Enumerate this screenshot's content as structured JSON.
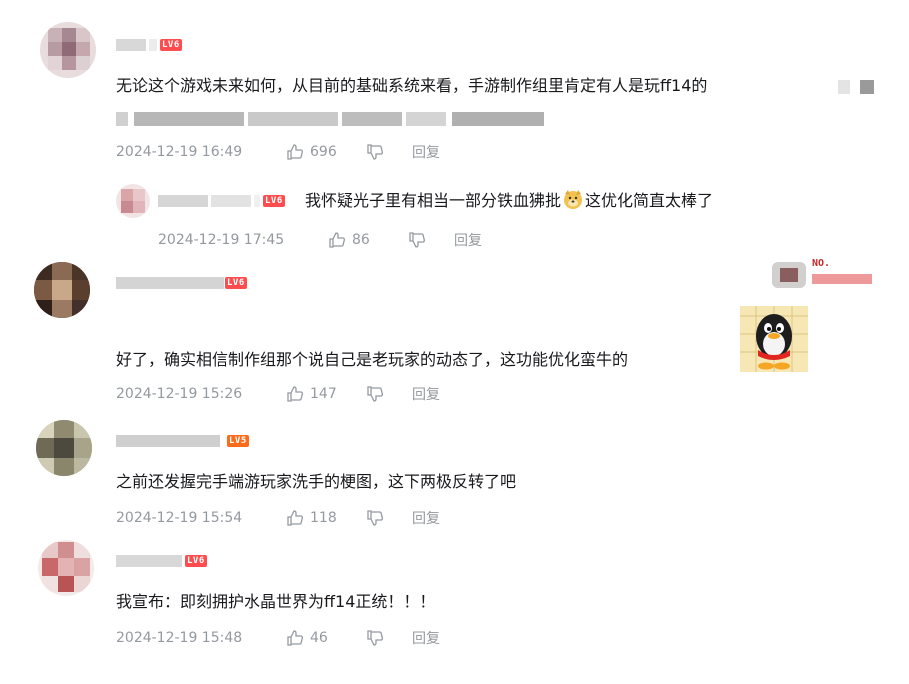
{
  "comments": [
    {
      "level": "LV6",
      "text": "无论这个游戏未来如何，从目前的基础系统来看，手游制作组里肯定有人是玩ff14的",
      "time": "2024-12-19 16:49",
      "likes": "696",
      "reply_label": "回复",
      "replies": [
        {
          "level": "LV6",
          "text": "我怀疑光子里有相当一部分铁血狒批",
          "text_after_emoji": "这优化简直太棒了",
          "time": "2024-12-19 17:45",
          "likes": "86",
          "reply_label": "回复"
        }
      ]
    },
    {
      "level": "LV6",
      "text": "好了，确实相信制作组那个说自己是老玩家的动态了，这功能优化蛮牛的",
      "time": "2024-12-19 15:26",
      "likes": "147",
      "reply_label": "回复",
      "badge": "NO."
    },
    {
      "level": "LV5",
      "text": "之前还发握完手端游玩家洗手的梗图，这下两极反转了吧",
      "time": "2024-12-19 15:54",
      "likes": "118",
      "reply_label": "回复"
    },
    {
      "level": "LV6",
      "text": "我宣布：即刻拥护水晶世界为ff14正统！！！",
      "time": "2024-12-19 15:48",
      "likes": "46",
      "reply_label": "回复"
    }
  ],
  "icons": {
    "like": "thumbs-up-icon",
    "dislike": "thumbs-down-icon"
  },
  "colors": {
    "level6": "#ff4d4f",
    "level5": "#ff6a1a",
    "meta": "#9499a0",
    "text": "#18191c"
  }
}
